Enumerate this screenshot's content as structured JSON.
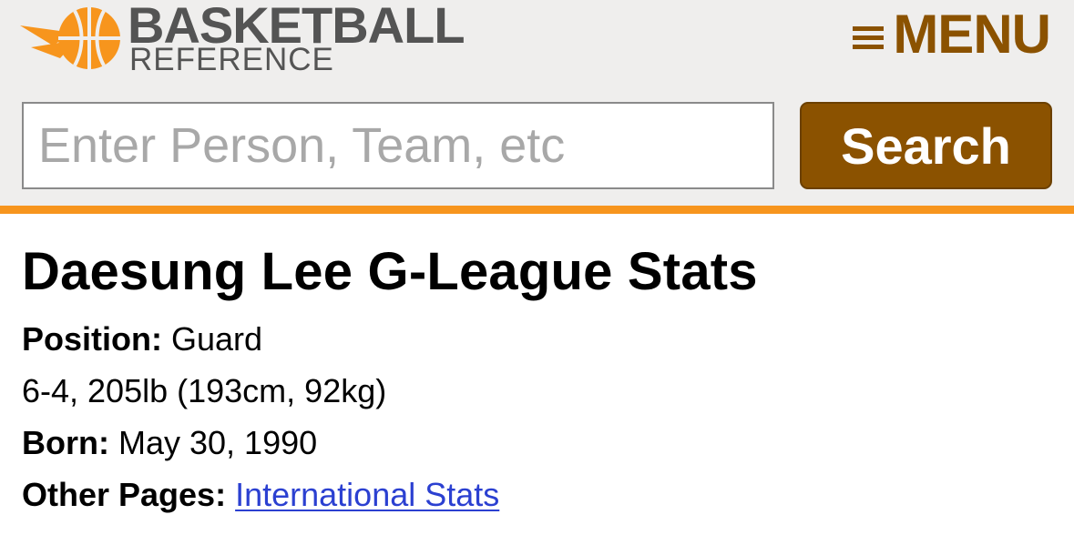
{
  "header": {
    "logo": {
      "word_top": "BASKETBALL",
      "word_bottom": "REFERENCE",
      "mark_icon": "basketball-icon"
    },
    "menu": {
      "icon": "hamburger-icon",
      "label": "MENU"
    },
    "search": {
      "placeholder": "Enter Person, Team, etc",
      "value": "",
      "button_label": "Search"
    }
  },
  "player": {
    "title": "Daesung Lee G-League Stats",
    "position_label": "Position:",
    "position_value": "Guard",
    "size": "6-4, 205lb (193cm, 92kg)",
    "born_label": "Born:",
    "born_value": "May 30, 1990",
    "other_pages_label": "Other Pages:",
    "other_pages_link": "International Stats"
  },
  "colors": {
    "header_bg": "#efeeed",
    "accent_orange": "#f7951d",
    "brand_brown": "#8b5200",
    "logo_gray": "#545454",
    "link_blue": "#2b40d1"
  }
}
